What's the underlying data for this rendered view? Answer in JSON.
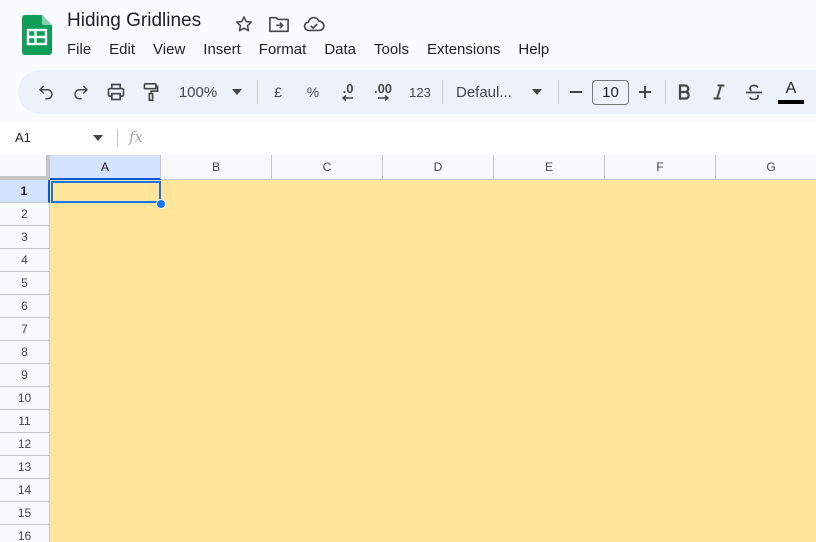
{
  "doc": {
    "title": "Hiding Gridlines"
  },
  "menu": [
    "File",
    "Edit",
    "View",
    "Insert",
    "Format",
    "Data",
    "Tools",
    "Extensions",
    "Help"
  ],
  "toolbar": {
    "zoom": "100%",
    "currency": "£",
    "percent": "%",
    "decrease_decimal": ".0",
    "increase_decimal": ".00",
    "more_formats": "123",
    "font": "Defaul...",
    "font_size": "10",
    "text_color_label": "A",
    "icons": [
      "undo-icon",
      "redo-icon",
      "print-icon",
      "paint-format-icon",
      "chevron-down-icon",
      "minus-icon",
      "plus-icon",
      "bold-icon",
      "italic-icon",
      "strikethrough-icon",
      "text-color-icon"
    ]
  },
  "formula_bar": {
    "name_box": "A1",
    "fx": "fx",
    "content": ""
  },
  "grid": {
    "columns": [
      "A",
      "B",
      "C",
      "D",
      "E",
      "F",
      "G"
    ],
    "rows": [
      "1",
      "2",
      "3",
      "4",
      "5",
      "6",
      "7",
      "8",
      "9",
      "10",
      "11",
      "12",
      "13",
      "14",
      "15",
      "16"
    ],
    "selected_cell": "A1",
    "fill_color": "#fee599"
  },
  "colors": {
    "accent": "#1a73e8",
    "sheets_green": "#0f9d58"
  }
}
